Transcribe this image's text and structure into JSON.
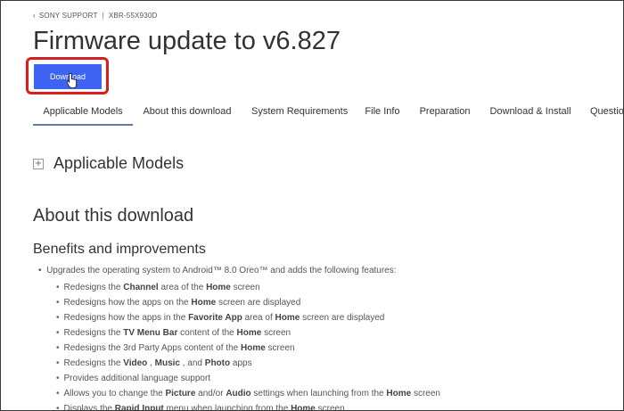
{
  "breadcrumb": {
    "back_glyph": "‹",
    "item1": "SONY SUPPORT",
    "separator": "|",
    "item2": "XBR-55X930D"
  },
  "page_title": "Firmware update to v6.827",
  "download_button": {
    "label": "Download",
    "highlight_color": "#d81e1e",
    "bg_color": "#3d63f2"
  },
  "tabs": [
    {
      "label": "Applicable Models",
      "active": true
    },
    {
      "label": "About this download",
      "active": false
    },
    {
      "label": "System Requirements",
      "active": false
    },
    {
      "label": "File Info",
      "active": false
    },
    {
      "label": "Preparation",
      "active": false
    },
    {
      "label": "Download & Install",
      "active": false
    },
    {
      "label": "Questio",
      "active": false
    }
  ],
  "applicable_models": {
    "expand_glyph": "+",
    "title": "Applicable Models"
  },
  "about": {
    "title": "About this download",
    "benefits_title": "Benefits and improvements",
    "main_bullet": "Upgrades the operating system to Android™ 8.0 Oreo™ and adds the following features:",
    "features": [
      [
        {
          "t": "Redesigns the "
        },
        {
          "t": "Channel",
          "b": true
        },
        {
          "t": " area of the "
        },
        {
          "t": "Home",
          "b": true
        },
        {
          "t": " screen"
        }
      ],
      [
        {
          "t": "Redesigns how the apps on the "
        },
        {
          "t": "Home",
          "b": true
        },
        {
          "t": " screen are displayed"
        }
      ],
      [
        {
          "t": "Redesigns how the apps in the "
        },
        {
          "t": "Favorite App",
          "b": true
        },
        {
          "t": " area of "
        },
        {
          "t": "Home",
          "b": true
        },
        {
          "t": " screen are displayed"
        }
      ],
      [
        {
          "t": "Redesigns the "
        },
        {
          "t": "TV Menu Bar",
          "b": true
        },
        {
          "t": " content of the "
        },
        {
          "t": "Home",
          "b": true
        },
        {
          "t": " screen"
        }
      ],
      [
        {
          "t": "Redesigns the 3rd Party Apps content of the "
        },
        {
          "t": "Home",
          "b": true
        },
        {
          "t": " screen"
        }
      ],
      [
        {
          "t": "Redesigns the "
        },
        {
          "t": "Video",
          "b": true
        },
        {
          "t": " , "
        },
        {
          "t": "Music",
          "b": true
        },
        {
          "t": " , and "
        },
        {
          "t": "Photo",
          "b": true
        },
        {
          "t": " apps"
        }
      ],
      [
        {
          "t": "Provides additional language support"
        }
      ],
      [
        {
          "t": "Allows you to change the "
        },
        {
          "t": "Picture",
          "b": true
        },
        {
          "t": " and/or "
        },
        {
          "t": "Audio",
          "b": true
        },
        {
          "t": " settings when launching from the "
        },
        {
          "t": "Home",
          "b": true
        },
        {
          "t": " screen"
        }
      ],
      [
        {
          "t": "Displays the "
        },
        {
          "t": "Rapid Input",
          "b": true
        },
        {
          "t": " menu when launching from the "
        },
        {
          "t": "Home",
          "b": true
        },
        {
          "t": " screen"
        }
      ]
    ]
  }
}
